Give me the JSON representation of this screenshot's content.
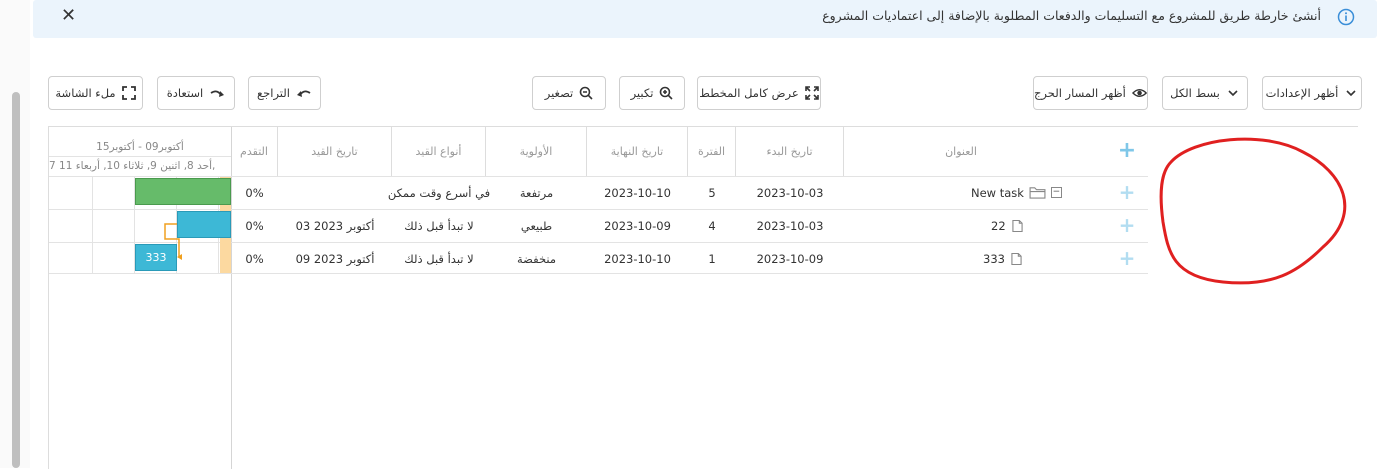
{
  "banner": {
    "message": "أنشئ خارطة طريق للمشروع مع التسليمات والدفعات المطلوبة بالإضافة إلى اعتماديات المشروع",
    "close_glyph": "✕"
  },
  "toolbar": {
    "show_settings": "أظهر الإعدادات",
    "collapse_all": "بسط الكل",
    "show_critical_path": "أظهر المسار الحرج",
    "fit_chart": "عرض كامل المخطط",
    "zoom_in": "تكبير",
    "zoom_out": "تصغير",
    "undo": "التراجع",
    "redo": "استعادة",
    "fullscreen": "ملء الشاشة"
  },
  "gantt": {
    "week_range": "أكتوبر09 - أكتوبر15",
    "day_labels": "7   أحد 8,  اثنين 9,  ثلاثاء 10,  أربعاء 11,",
    "bars": [
      {
        "task": "New task",
        "color": "#66bb6a"
      },
      {
        "task": "22",
        "color": "#3db8d6"
      },
      {
        "task": "333",
        "label": "333",
        "color": "#3db8d6"
      }
    ],
    "dependency_color": "#f0a020",
    "today_color": "#fcd9a0"
  },
  "table": {
    "headers": {
      "title": "العنوان",
      "start_date": "تاريخ البدء",
      "duration": "الفترة",
      "end_date": "تاريخ النهاية",
      "priority": "الأولوية",
      "constraint_type": "أنواع القيد",
      "constraint_date": "تاريخ القيد",
      "progress": "التقدم"
    },
    "rows": [
      {
        "title": "New task",
        "start": "2023-10-03",
        "duration": "5",
        "end": "2023-10-10",
        "priority": "مرتفعة",
        "constraint_type": "في أسرع وقت ممكن",
        "constraint_date": "",
        "progress": "0%"
      },
      {
        "title": "22",
        "start": "2023-10-03",
        "duration": "4",
        "end": "2023-10-09",
        "priority": "طبيعي",
        "constraint_type": "لا تبدأ قبل ذلك",
        "constraint_date": "أكتوبر 2023 03",
        "progress": "0%"
      },
      {
        "title": "333",
        "start": "2023-10-09",
        "duration": "1",
        "end": "2023-10-10",
        "priority": "منخفضة",
        "constraint_type": "لا تبدأ قبل ذلك",
        "constraint_date": "أكتوبر 2023 09",
        "progress": "0%"
      }
    ]
  },
  "icons": {
    "plus": "+",
    "collapse": "−"
  },
  "colors": {
    "banner_bg": "#ebf4fc",
    "info_icon": "#3a8ed8",
    "annotation_circle": "#e02020",
    "plus": "#7fc7e8"
  }
}
